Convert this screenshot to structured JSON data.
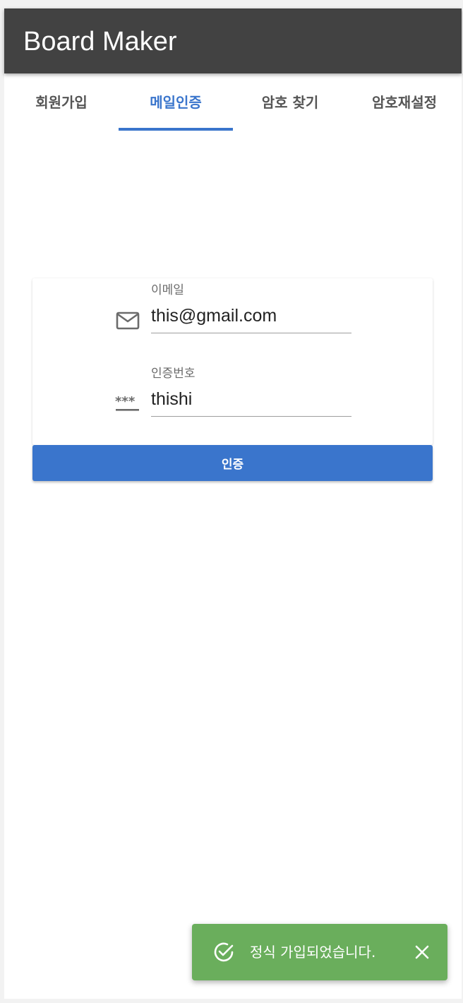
{
  "app": {
    "title": "Board Maker"
  },
  "tabs": [
    {
      "label": "회원가입",
      "active": false
    },
    {
      "label": "메일인증",
      "active": true
    },
    {
      "label": "암호 찾기",
      "active": false
    },
    {
      "label": "암호재설정",
      "active": false
    }
  ],
  "form": {
    "email": {
      "label": "이메일",
      "value": "this@gmail.com",
      "icon": "mail-icon"
    },
    "code": {
      "label": "인증번호",
      "value": "thishi",
      "icon": "password-icon"
    },
    "submit_label": "인증"
  },
  "snackbar": {
    "message": "정식 가입되었습니다.",
    "icon": "check-circle-icon",
    "close_icon": "close-icon",
    "color": "#6aae5c"
  },
  "colors": {
    "appbar": "#424242",
    "accent": "#3a75cc"
  }
}
